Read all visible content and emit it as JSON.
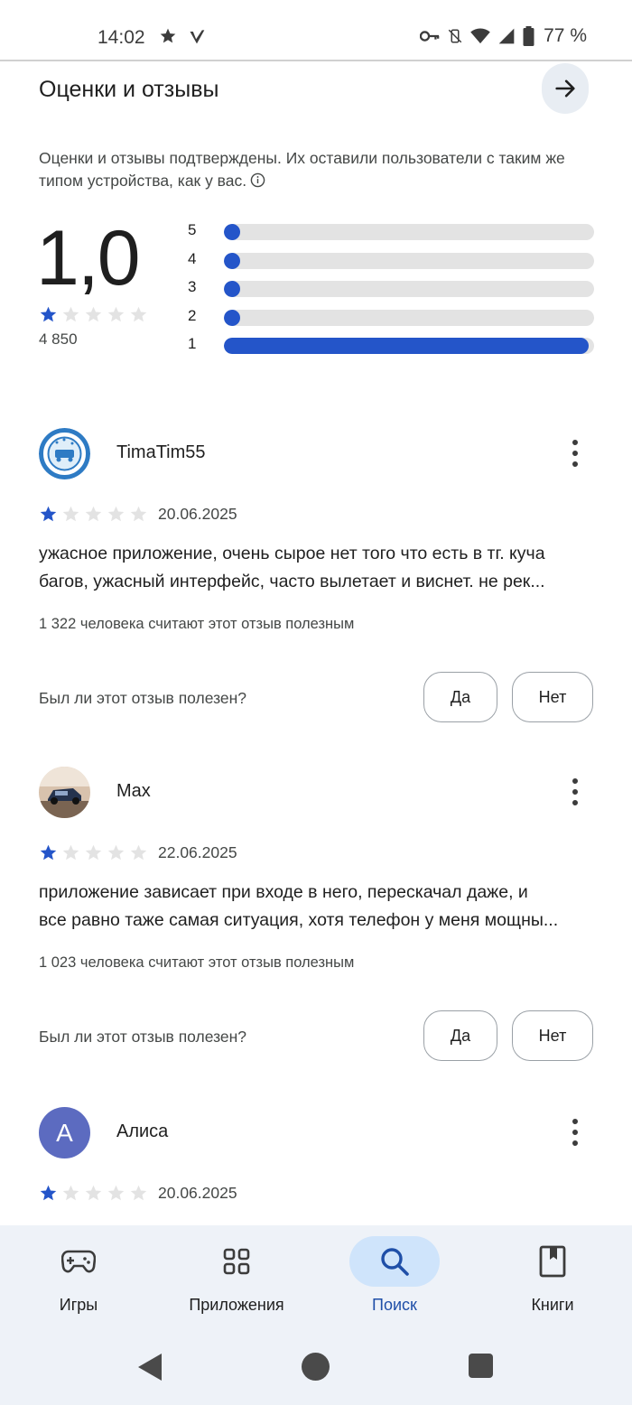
{
  "status_bar": {
    "time": "14:02",
    "battery": "77 %",
    "icons": [
      "star-icon",
      "check-mark-icon",
      "key-icon",
      "vibrate-off-icon",
      "wifi-icon",
      "signal-icon",
      "battery-icon"
    ]
  },
  "section": {
    "title": "Оценки и отзывы",
    "verified_note": "Оценки и отзывы подтверждены. Их оставили пользователи с таким же типом устройства, как у вас."
  },
  "summary": {
    "rating": "1,0",
    "stars_filled": 1,
    "stars_total": 5,
    "count": "4 850",
    "distribution": [
      {
        "label": "5",
        "fraction": 0.0
      },
      {
        "label": "4",
        "fraction": 0.0
      },
      {
        "label": "3",
        "fraction": 0.0
      },
      {
        "label": "2",
        "fraction": 0.0
      },
      {
        "label": "1",
        "fraction": 0.985
      }
    ]
  },
  "reviews": [
    {
      "name": "TimaTim55",
      "stars": 1,
      "date": "20.06.2025",
      "text_line1": "ужасное приложение, очень сырое нет того что есть в тг. куча",
      "text_line2": "багов, ужасный интерфейс, часто вылетает и виснет. не рек...",
      "helpful": "1 322 человека считают этот отзыв полезным",
      "question": "Был ли этот отзыв полезен?",
      "yes": "Да",
      "no": "Нет"
    },
    {
      "name": "Max",
      "stars": 1,
      "date": "22.06.2025",
      "text_line1": "приложение зависает при входе в него, перескачал даже, и",
      "text_line2": "все равно таже самая ситуация, хотя телефон у меня мощны...",
      "helpful": "1 023 человека считают этот отзыв полезным",
      "question": "Был ли этот отзыв полезен?",
      "yes": "Да",
      "no": "Нет"
    },
    {
      "name": "Алиса",
      "avatar_letter": "А",
      "stars": 1,
      "date": "20.06.2025"
    }
  ],
  "bottom_nav": {
    "items": [
      {
        "label": "Игры",
        "icon": "gamepad-icon"
      },
      {
        "label": "Приложения",
        "icon": "apps-grid-icon"
      },
      {
        "label": "Поиск",
        "icon": "search-icon",
        "active": true
      },
      {
        "label": "Книги",
        "icon": "book-icon"
      }
    ]
  },
  "colors": {
    "accent": "#2455c9",
    "star_empty": "#e3e3e3",
    "nav_bg": "#eef2f8",
    "nav_active_bg": "#cfe4fb",
    "avatar_alisa": "#5c6bc0"
  }
}
